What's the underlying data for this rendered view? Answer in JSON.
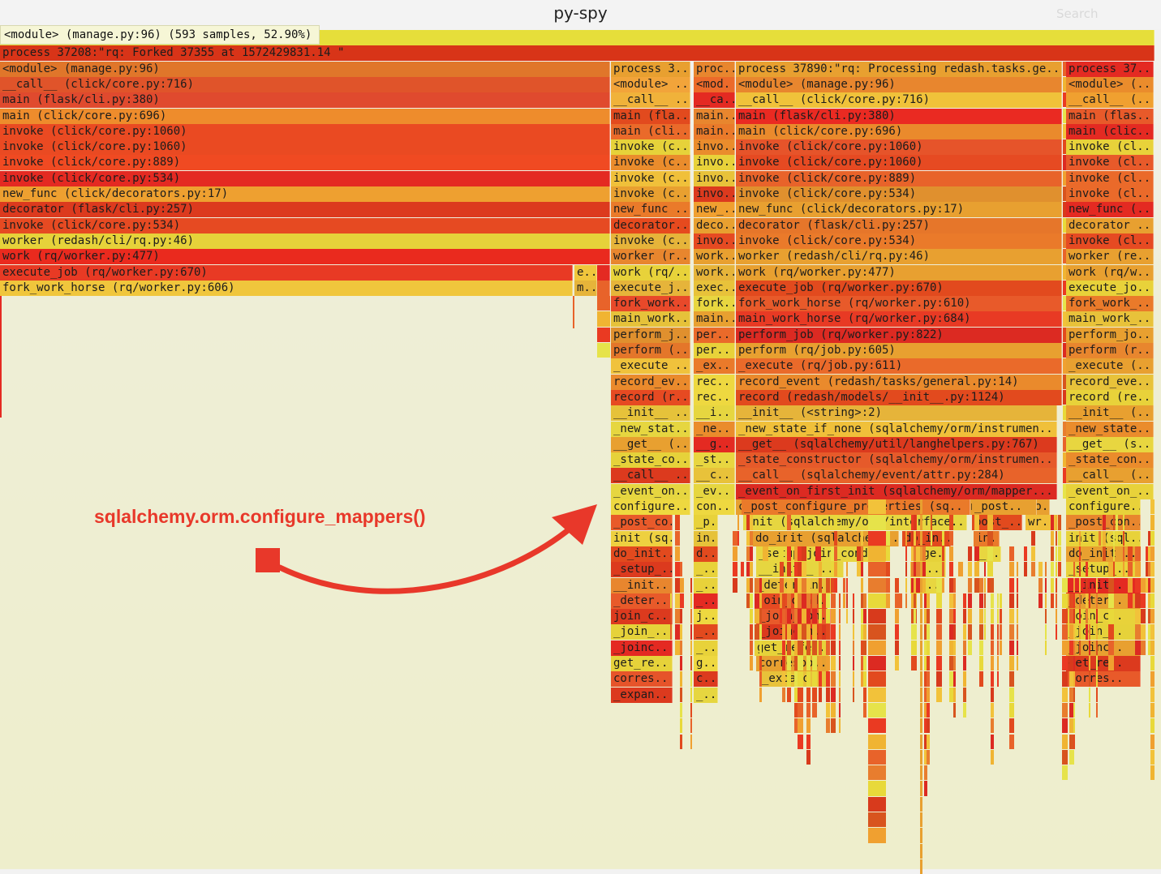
{
  "app": {
    "title": "py-spy",
    "search_placeholder": "Search"
  },
  "tooltip": "<module> (manage.py:96) (593 samples, 52.90%)",
  "annotation": {
    "text": "sqlalchemy.orm.configure_mappers()",
    "color": "#e8382a"
  },
  "flamegraph": {
    "root_row": "process 37208:\"rq: Forked 37355 at 1572429831.14 \"",
    "left_stack": [
      "<module> (manage.py:96)",
      "__call__ (click/core.py:716)",
      "main (flask/cli.py:380)",
      "main (click/core.py:696)",
      "invoke (click/core.py:1060)",
      "invoke (click/core.py:1060)",
      "invoke (click/core.py:889)",
      "invoke (click/core.py:534)",
      "new_func (click/decorators.py:17)",
      "decorator (flask/cli.py:257)",
      "invoke (click/core.py:534)",
      "worker (redash/cli/rq.py:46)",
      "work (rq/worker.py:477)",
      "execute_job (rq/worker.py:670)",
      "fork_work_horse (rq/worker.py:606)"
    ],
    "left_small": [
      "e..",
      "m.."
    ],
    "col_a": [
      "process 3..",
      "<module> ..",
      "__call__ ..",
      "main (fla..",
      "main (cli..",
      "invoke (c..",
      "invoke (c..",
      "invoke (c..",
      "invoke (c..",
      "new_func ..",
      "decorator..",
      "invoke (c..",
      "worker (r..",
      "work (rq/..",
      "execute_j..",
      "fork_work..",
      "main_work..",
      "perform_j..",
      "perform (..",
      "_execute ..",
      "record_ev..",
      "record (r..",
      "__init__ ..",
      "_new_stat..",
      "__get__ (..",
      "_state_co..",
      "__call__ ..",
      "_event_on..",
      "configure..",
      "_post_co..",
      "init (sq..",
      "do_init..",
      "_setup_..",
      "__init..",
      "_deter..",
      "join_c..",
      "_join_..",
      "_joinc..",
      "get_re..",
      "corres..",
      "_expan.."
    ],
    "col_b": [
      "proc..",
      "<mod.",
      "__ca..",
      "main..",
      "main..",
      "invo..",
      "invo..",
      "invo..",
      "invo..",
      "new_..",
      "deco..",
      "invo..",
      "work..",
      "work..",
      "exec..",
      "fork..",
      "main..",
      "per..",
      "per..",
      "_ex..",
      "rec..",
      "rec..",
      "__i..",
      "_ne..",
      "__g..",
      "_st..",
      "__c..",
      "_ev..",
      "con..",
      "_p..",
      "in..",
      "d..",
      "_..",
      "_..",
      "_..",
      "j..",
      "_..",
      "_..",
      "g..",
      "c..",
      "_.."
    ],
    "col_c": [
      "process 37890:\"rq: Processing redash.tasks.ge..",
      "<module> (manage.py:96)",
      "__call__ (click/core.py:716)",
      "main (flask/cli.py:380)",
      "main (click/core.py:696)",
      "invoke (click/core.py:1060)",
      "invoke (click/core.py:1060)",
      "invoke (click/core.py:889)",
      "invoke (click/core.py:534)",
      "new_func (click/decorators.py:17)",
      "decorator (flask/cli.py:257)",
      "invoke (click/core.py:534)",
      "worker (redash/cli/rq.py:46)",
      "work (rq/worker.py:477)",
      "execute_job (rq/worker.py:670)",
      "fork_work_horse (rq/worker.py:610)",
      "main_work_horse (rq/worker.py:684)",
      "perform_job (rq/worker.py:822)",
      "perform (rq/job.py:605)",
      "_execute (rq/job.py:611)",
      "record_event (redash/tasks/general.py:14)",
      "record (redash/models/__init__.py:1124)",
      "__init__ (<string>:2)",
      "_new_state_if_none (sqlalchemy/orm/instrumen..",
      "__get__ (sqlalchemy/util/langhelpers.py:767)",
      "_state_constructor (sqlalchemy/orm/instrumen..",
      "__call__ (sqlalchemy/event/attr.py:284)",
      "_event_on_first_init (sqlalchemy/orm/mapper...",
      "configure_mappers (sqlalchemy/orm/mappe.."
    ],
    "col_c_extra": {
      "co": "co..",
      "post_config": "_post_configure_properties (sq..",
      "post2": "_post..",
      "dots": "_..",
      "init": "init (sqlalchemy/orm/interface..",
      "post3": "post_..",
      "wr": "wr..",
      "do_init": "do_init (sqlalchemy..",
      "do_in": "do_in..",
      "in": "in..",
      "setup_join": "_setup_join_conditi..",
      "ge": "_ge..",
      "dots2": "_..",
      "init2": "__init__ ..",
      "c": "_c..",
      "determin": "_determin..",
      "in2": "in..",
      "join_cond": "join_cond..",
      "join_con": "_join_con..",
      "joincon": "_joincon..",
      "get_refe": "get_refe..",
      "correspo": "correspo..",
      "expand": "_expand.."
    },
    "col_d": [
      "process 37..",
      "<module> (..",
      "__call__ (..",
      "main (flas..",
      "main (clic..",
      "invoke (cl..",
      "invoke (cl..",
      "invoke (cl..",
      "invoke (cl..",
      "new_func (..",
      "decorator ..",
      "invoke (cl..",
      "worker (re..",
      "work (rq/w..",
      "execute_jo..",
      "fork_work_..",
      "main_work_..",
      "perform_jo..",
      "perform (r..",
      "_execute (..",
      "record_eve..",
      "record (re..",
      "__init__ (..",
      "_new_state..",
      "__get__ (s..",
      "_state_con..",
      "__call__ (..",
      "_event_on_..",
      "configure..",
      "_post_con..",
      "init (sql..",
      "do_init ..",
      "_setup_..",
      "__init..",
      "_deter..",
      "join_c..",
      "_join_..",
      "_joinc..",
      "get_re..",
      "corres.."
    ]
  }
}
